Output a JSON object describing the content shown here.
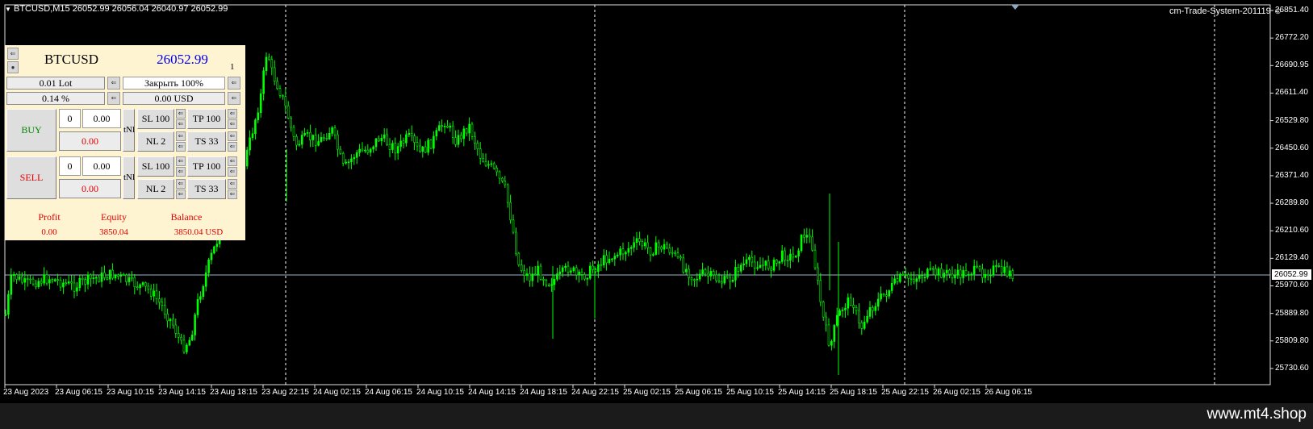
{
  "chart": {
    "symbol_info": "BTCUSD,M15  26052.99 26056.04 26040.97 26052.99",
    "indicator_name": "cm-Trade-System-201119",
    "smiley_icon": "smiley-icon",
    "current_price": "26052.99",
    "price_levels": [
      "26851.40",
      "26772.20",
      "26690.95",
      "26611.40",
      "26529.80",
      "26450.60",
      "26371.40",
      "26289.80",
      "26210.60",
      "26129.40",
      "26052.99",
      "25970.60",
      "25889.80",
      "25809.80",
      "25730.60"
    ],
    "time_labels": [
      "23 Aug 2023",
      "23 Aug 06:15",
      "23 Aug 10:15",
      "23 Aug 14:15",
      "23 Aug 18:15",
      "23 Aug 22:15",
      "24 Aug 02:15",
      "24 Aug 06:15",
      "24 Aug 10:15",
      "24 Aug 14:15",
      "24 Aug 18:15",
      "24 Aug 22:15",
      "25 Aug 02:15",
      "25 Aug 06:15",
      "25 Aug 10:15",
      "25 Aug 14:15",
      "25 Aug 18:15",
      "25 Aug 22:15",
      "26 Aug 02:15",
      "26 Aug 06:15"
    ],
    "colors": {
      "candles": "#00ff00",
      "background": "#000000",
      "grid_separator": "#ffffff",
      "price_line": "#9fb3c8"
    }
  },
  "panel": {
    "symbol": "BTCUSD",
    "price": "26052.99",
    "small_digit": "1",
    "lot": "0.01 Lot",
    "close_label": "Закрыть 100%",
    "risk_percent": "0.14 %",
    "usd_value": "0.00 USD",
    "buy": {
      "label": "BUY",
      "count": "0",
      "volume": "0.00",
      "profit": "0.00"
    },
    "sell": {
      "label": "SELL",
      "count": "0",
      "volume": "0.00",
      "profit": "0.00"
    },
    "tn_label": "tNl",
    "sl_label": "SL 100",
    "tp_label": "TP 100",
    "nl_label": "NL 2",
    "ts_label": "TS 33",
    "footer": {
      "profit_label": "Profit",
      "equity_label": "Equity",
      "balance_label": "Balance",
      "profit_value": "0.00",
      "equity_value": "3850.04",
      "balance_value": "3850.04 USD"
    },
    "arrow_icon": "arrow-icon",
    "drop_icon": "drop-icon"
  },
  "watermark": "www.mt4.shop"
}
